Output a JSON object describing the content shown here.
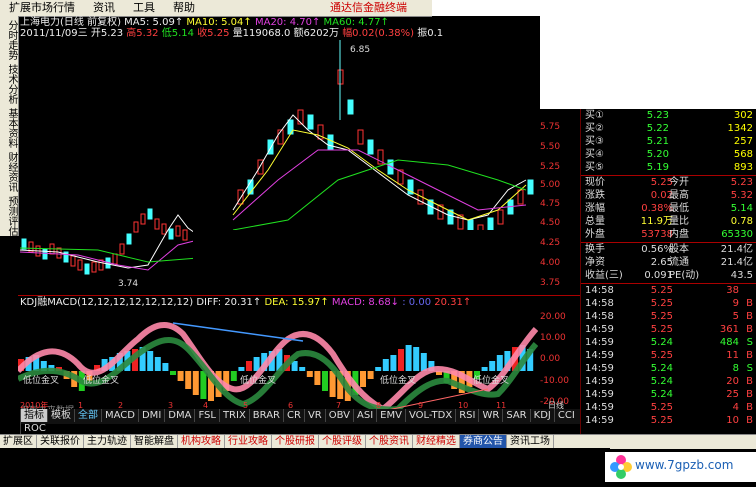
{
  "menu": [
    "扩展市场行情",
    "资讯",
    "工具",
    "帮助"
  ],
  "brand": "通达信金融终端",
  "sidebar_tabs": [
    "分时走势",
    "技术分析",
    "基本资料",
    "财经资讯",
    "预测评估"
  ],
  "title_row": {
    "name": "上海电力(日线 前复权)",
    "ma5": "MA5: 5.09↑",
    "ma10": "MA10: 5.04↑",
    "ma20": "MA20: 4.70↑",
    "ma60": "MA60: 4.77↑"
  },
  "date_row": {
    "date": "2011/11/09三",
    "open": "开5.23",
    "high": "高5.32",
    "low": "低5.14",
    "close": "收5.25",
    "vol": "量119068.0",
    "amount": "额6202万",
    "change": "幅0.02(0.38%)",
    "amp": "振0.1"
  },
  "main_chart": {
    "ymax_label": "6.85",
    "yticks": [
      "5.75",
      "5.50",
      "5.25",
      "5.00",
      "4.75",
      "4.50",
      "4.25",
      "4.00",
      "3.75"
    ],
    "low_label": "3.74"
  },
  "macd_row": {
    "label": "KDJ融MACD(12,12,12,12,12,12,12)",
    "diff": "DIFF: 20.31↑",
    "dea": "DEA: 15.97↑",
    "macd": "MACD: 8.68↓",
    "val1": ": 0.00",
    "val2": "20.31↑"
  },
  "macd_chart": {
    "yticks": [
      "20.00",
      "10.00",
      "0.00",
      "-10.00",
      "-20.00"
    ],
    "annotations": [
      "低位金叉",
      "低位金叉",
      "低位金叉",
      "低位金叉",
      "低位金叉"
    ],
    "note": "用到未来数据"
  },
  "timeline": [
    "2010年",
    "1",
    "2",
    "3",
    "4",
    "5",
    "6",
    "7",
    "8",
    "9",
    "10",
    "11",
    "日线"
  ],
  "indicator_tabs": [
    "指标",
    "模板",
    "全部",
    "MACD",
    "DMI",
    "DMA",
    "FSL",
    "TRIX",
    "BRAR",
    "CR",
    "VR",
    "OBV",
    "ASI",
    "EMV",
    "VOL-TDX",
    "RSI",
    "WR",
    "SAR",
    "KDJ",
    "CCI",
    "ROC"
  ],
  "bottom_tabs": [
    "扩展区",
    "关联报价",
    "主力轨迹",
    "智能解盘",
    "机构攻略",
    "行业攻略",
    "个股研报",
    "个股评级",
    "个股资讯",
    "财经精选",
    "券商公告",
    "资讯工场"
  ],
  "order_book": [
    {
      "label": "买①",
      "price": "5.23",
      "vol": "302"
    },
    {
      "label": "买②",
      "price": "5.22",
      "vol": "1342"
    },
    {
      "label": "买③",
      "price": "5.21",
      "vol": "257"
    },
    {
      "label": "买④",
      "price": "5.20",
      "vol": "568"
    },
    {
      "label": "买⑤",
      "price": "5.19",
      "vol": "893"
    }
  ],
  "quote": [
    {
      "l1": "现价",
      "v1": "5.25",
      "l2": "今开",
      "v2": "5.23"
    },
    {
      "l1": "涨跌",
      "v1": "0.02",
      "l2": "最高",
      "v2": "5.32"
    },
    {
      "l1": "涨幅",
      "v1": "0.38%",
      "l2": "最低",
      "v2": "5.14"
    },
    {
      "l1": "总量",
      "v1": "11.9万",
      "l2": "量比",
      "v2": "0.78"
    },
    {
      "l1": "外盘",
      "v1": "53738",
      "l2": "内盘",
      "v2": "65330"
    }
  ],
  "fundamentals": [
    {
      "l1": "换手",
      "v1": "0.56%",
      "l2": "股本",
      "v2": "21.4亿"
    },
    {
      "l1": "净资",
      "v1": "2.65",
      "l2": "流通",
      "v2": "21.4亿"
    },
    {
      "l1": "收益(三)",
      "v1": "0.091",
      "l2": "PE(动)",
      "v2": "43.5"
    }
  ],
  "ticks": [
    {
      "time": "14:58",
      "price": "5.25",
      "vol": "38",
      "flag": ""
    },
    {
      "time": "14:58",
      "price": "5.25",
      "vol": "9",
      "flag": "B"
    },
    {
      "time": "14:58",
      "price": "5.25",
      "vol": "5",
      "flag": "B"
    },
    {
      "time": "14:59",
      "price": "5.25",
      "vol": "361",
      "flag": "B"
    },
    {
      "time": "14:59",
      "price": "5.24",
      "vol": "484",
      "flag": "S"
    },
    {
      "time": "14:59",
      "price": "5.25",
      "vol": "11",
      "flag": "B"
    },
    {
      "time": "14:59",
      "price": "5.24",
      "vol": "8",
      "flag": "S"
    },
    {
      "time": "14:59",
      "price": "5.24",
      "vol": "20",
      "flag": "B"
    },
    {
      "time": "14:59",
      "price": "5.24",
      "vol": "25",
      "flag": "B"
    },
    {
      "time": "14:59",
      "price": "5.25",
      "vol": "4",
      "flag": "B"
    },
    {
      "time": "14:59",
      "price": "5.25",
      "vol": "10",
      "flag": "B"
    }
  ],
  "watermark": "www.7gpzb.com"
}
